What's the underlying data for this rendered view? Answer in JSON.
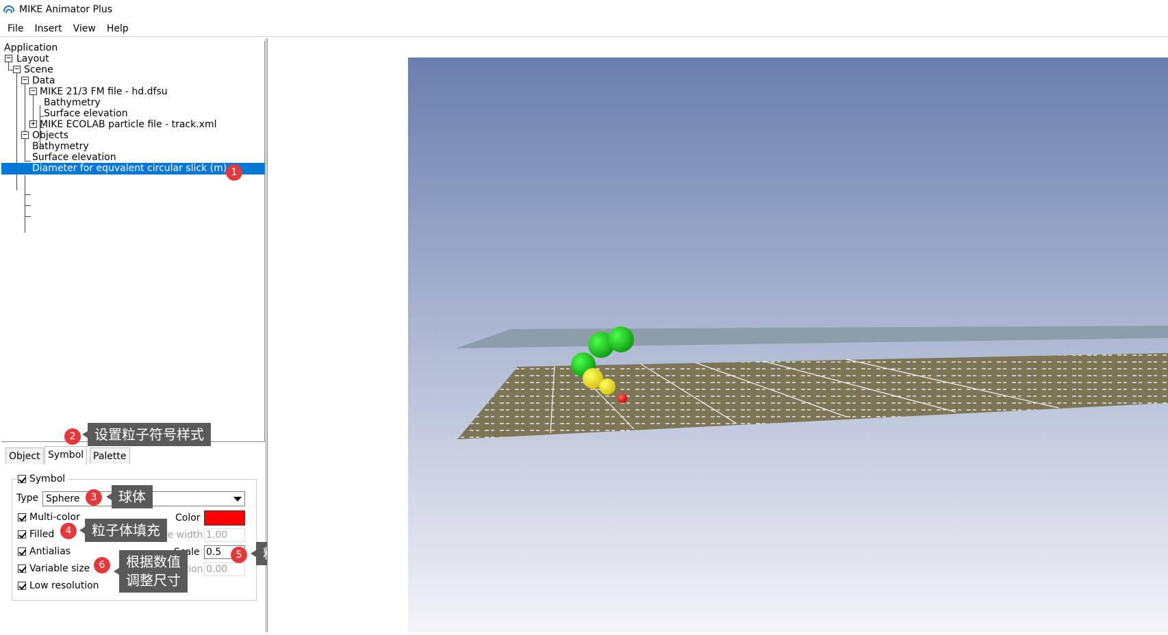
{
  "window": {
    "title": "MIKE Animator Plus"
  },
  "menu": [
    "File",
    "Insert",
    "View",
    "Help"
  ],
  "tree": {
    "application": "Application",
    "layout": "Layout",
    "scene": "Scene",
    "data": "Data",
    "mike_fm_file": "MIKE 21/3 FM file - hd.dfsu",
    "bathymetry_data": "Bathymetry",
    "surface_elevation_data": "Surface elevation",
    "ecolab_file": "MIKE ECOLAB particle file - track.xml",
    "objects": "Objects",
    "bathymetry_obj": "Bathymetry",
    "surface_elevation_obj": "Surface elevation",
    "diameter_obj": "Diameter for equvalent circular slick (m)"
  },
  "tabs": [
    "Object",
    "Symbol",
    "Palette"
  ],
  "active_tab": "Symbol",
  "symbol": {
    "group_label": "Symbol",
    "type_label": "Type",
    "type_value": "Sphere",
    "multi_color": "Multi-color",
    "color_label": "Color",
    "color_value": "#ff0000",
    "filled": "Filled",
    "line_width_label": "Line width",
    "line_width_value": "1.00",
    "antialias": "Antialias",
    "scale_label": "Scale",
    "scale_value": "0.5",
    "variable_size": "Variable size",
    "rotation_label": "Rotation",
    "rotation_value": "0.00",
    "low_resolution": "Low resolution"
  },
  "annotations": [
    {
      "num": "1",
      "text": ""
    },
    {
      "num": "2",
      "text": "设置粒子符号样式"
    },
    {
      "num": "3",
      "text": "球体"
    },
    {
      "num": "4",
      "text": "粒子体填充"
    },
    {
      "num": "5",
      "text": "粒子尺寸"
    },
    {
      "num": "6",
      "text_line1": "根据数值",
      "text_line2": "调整尺寸"
    }
  ],
  "colors": {
    "selection": "#0078d7",
    "badge": "#e23a3a",
    "callout": "#5a5a5a",
    "sky_top": "#6a7fae",
    "sky_bottom": "#f4f4f8",
    "seabed": "#7c7656",
    "water_plane": "#8a9aa6",
    "particle_green": "#19c419",
    "particle_yellow": "#f2e40e",
    "particle_red": "#ff0000"
  }
}
